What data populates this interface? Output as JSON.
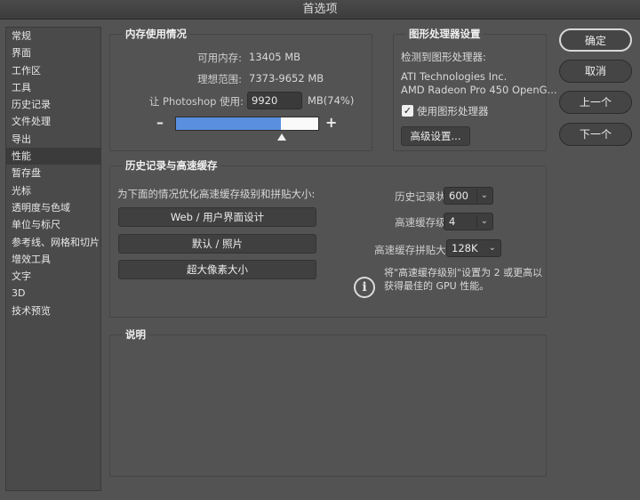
{
  "window": {
    "title": "首选项"
  },
  "sidebar": {
    "items": [
      {
        "label": "常规"
      },
      {
        "label": "界面"
      },
      {
        "label": "工作区"
      },
      {
        "label": "工具"
      },
      {
        "label": "历史记录"
      },
      {
        "label": "文件处理"
      },
      {
        "label": "导出"
      },
      {
        "label": "性能"
      },
      {
        "label": "暂存盘"
      },
      {
        "label": "光标"
      },
      {
        "label": "透明度与色域"
      },
      {
        "label": "单位与标尺"
      },
      {
        "label": "参考线、网格和切片"
      },
      {
        "label": "增效工具"
      },
      {
        "label": "文字"
      },
      {
        "label": "3D"
      },
      {
        "label": "技术预览"
      }
    ],
    "selected": "性能"
  },
  "memory": {
    "title": "内存使用情况",
    "available_label": "可用内存:",
    "available_value": "13405 MB",
    "ideal_label": "理想范围:",
    "ideal_value": "7373-9652 MB",
    "use_label": "让 Photoshop 使用:",
    "use_value": "9920",
    "use_unit": "MB(74%)",
    "slider_fraction": 0.74,
    "minus": "–",
    "plus": "+"
  },
  "gpu": {
    "title": "图形处理器设置",
    "detected_label": "检测到图形处理器:",
    "vendor": "ATI Technologies Inc.",
    "model": "AMD Radeon Pro 450 OpenG...",
    "use_gpu_label": "使用图形处理器",
    "use_gpu_checked": true,
    "advanced_button": "高级设置..."
  },
  "history_cache": {
    "title": "历史记录与高速缓存",
    "optimize_label": "为下面的情况优化高速缓存级别和拼贴大小:",
    "presets": [
      "Web / 用户界面设计",
      "默认 / 照片",
      "超大像素大小"
    ],
    "history_states_label": "历史记录状态:",
    "history_states_value": "600",
    "cache_levels_label": "高速缓存级别:",
    "cache_levels_value": "4",
    "tile_size_label": "高速缓存拼贴大小:",
    "tile_size_value": "128K",
    "info_line1": "将\"高速缓存级别\"设置为 2 或更高以",
    "info_line2": "获得最佳的 GPU 性能。"
  },
  "description": {
    "title": "说明"
  },
  "actions": {
    "ok": "确定",
    "cancel": "取消",
    "prev": "上一个",
    "next": "下一个"
  },
  "colors": {
    "slider_fill": "#5a8fe0",
    "background": "#535353"
  }
}
